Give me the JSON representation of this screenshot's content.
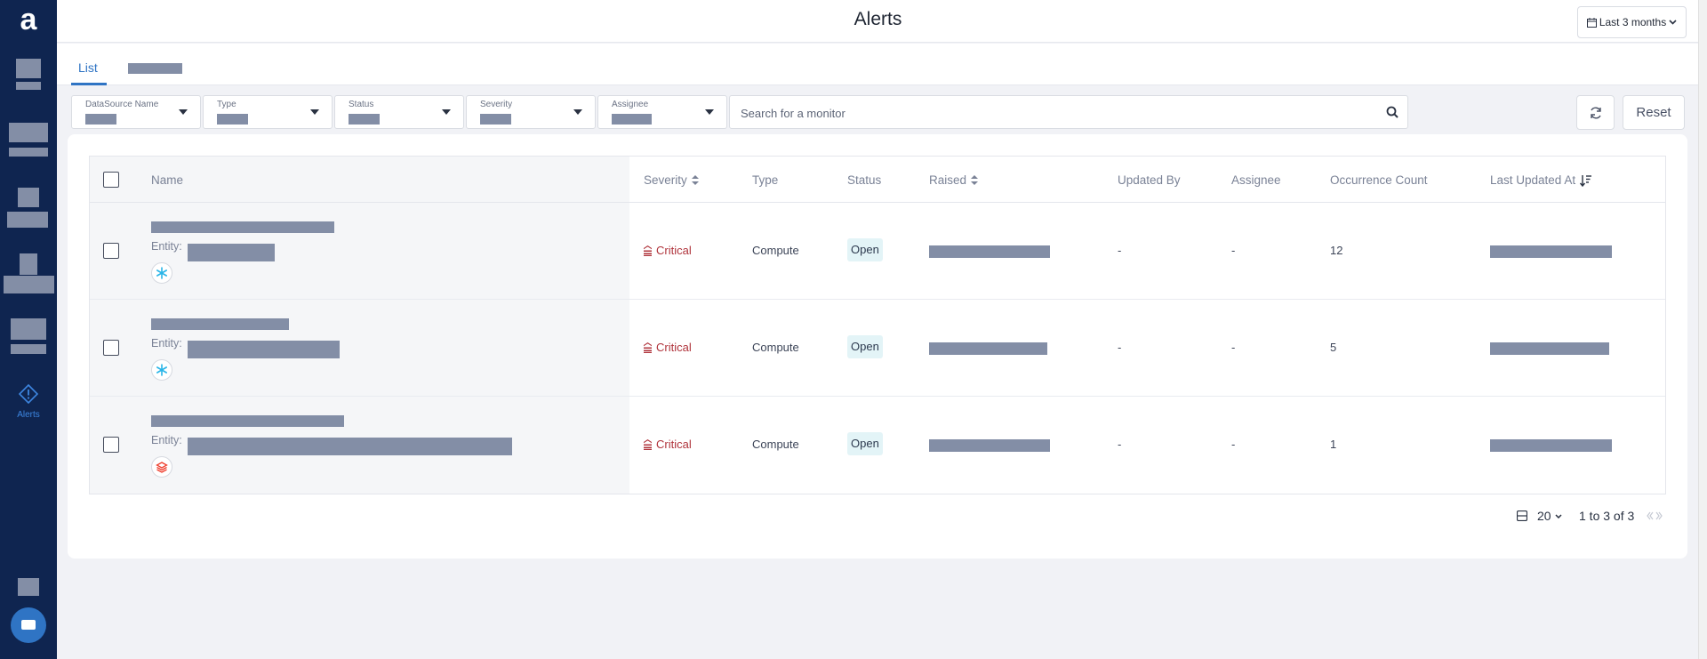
{
  "sidebar": {
    "logo_text": "a",
    "active_item_label": "Alerts"
  },
  "header": {
    "title": "Alerts",
    "date_range": "Last 3 months"
  },
  "tabs": [
    {
      "label": "List",
      "active": true
    }
  ],
  "filters": [
    {
      "label": "DataSource Name"
    },
    {
      "label": "Type"
    },
    {
      "label": "Status"
    },
    {
      "label": "Severity"
    },
    {
      "label": "Assignee"
    }
  ],
  "search": {
    "placeholder": "Search for a monitor"
  },
  "toolbar": {
    "reset_label": "Reset"
  },
  "table": {
    "columns": [
      "Name",
      "Severity",
      "Type",
      "Status",
      "Raised",
      "Updated By",
      "Assignee",
      "Occurrence Count",
      "Last Updated At"
    ],
    "entity_label": "Entity:",
    "rows": [
      {
        "severity": "Critical",
        "type": "Compute",
        "status": "Open",
        "updated_by": "-",
        "assignee": "-",
        "occurrence_count": "12",
        "source_icon": "snowflake-icon"
      },
      {
        "severity": "Critical",
        "type": "Compute",
        "status": "Open",
        "updated_by": "-",
        "assignee": "-",
        "occurrence_count": "5",
        "source_icon": "snowflake-icon"
      },
      {
        "severity": "Critical",
        "type": "Compute",
        "status": "Open",
        "updated_by": "-",
        "assignee": "-",
        "occurrence_count": "1",
        "source_icon": "databricks-icon"
      }
    ]
  },
  "pagination": {
    "page_size": "20",
    "range_text": "1 to 3 of 3"
  },
  "colors": {
    "sidebar_bg": "#0f2550",
    "accent": "#2f74c4",
    "critical": "#b0343c",
    "status_open_bg": "#e3f4f7"
  }
}
